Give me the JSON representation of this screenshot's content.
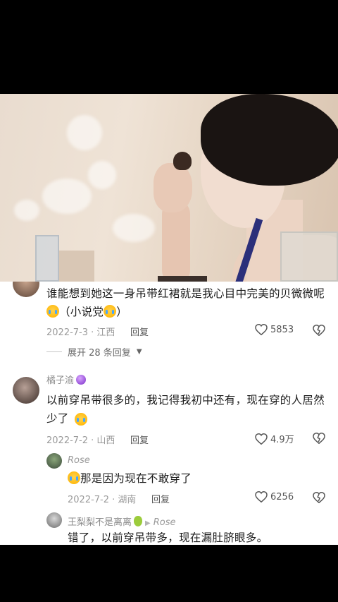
{
  "comments": [
    {
      "text_prefix": "谁能想到她这一身吊带红裙就是我心目中完美的贝微微呢",
      "text_suffix": "（小说党",
      "text_end": "）",
      "date_loc": "2022-7-3 · 江西",
      "reply_label": "回复",
      "likes": "5853",
      "expand_label": "展开 28 条回复"
    },
    {
      "username": "橘子渝",
      "text": "以前穿吊带很多的，我记得我初中还有，现在穿的人居然少了",
      "date_loc": "2022-7-2 · 山西",
      "reply_label": "回复",
      "likes": "4.9万"
    },
    {
      "username": "Rose",
      "text": "那是因为现在不敢穿了",
      "date_loc": "2022-7-2 · 湖南",
      "reply_label": "回复",
      "likes": "6256"
    },
    {
      "username": "王梨梨不是离离",
      "reply_to": "Rose",
      "text": "错了，以前穿吊带多，现在漏肚脐眼多。"
    }
  ],
  "icons": [
    "heart-icon",
    "dislike-icon",
    "chevron-down-icon",
    "crying-emoji-icon"
  ]
}
